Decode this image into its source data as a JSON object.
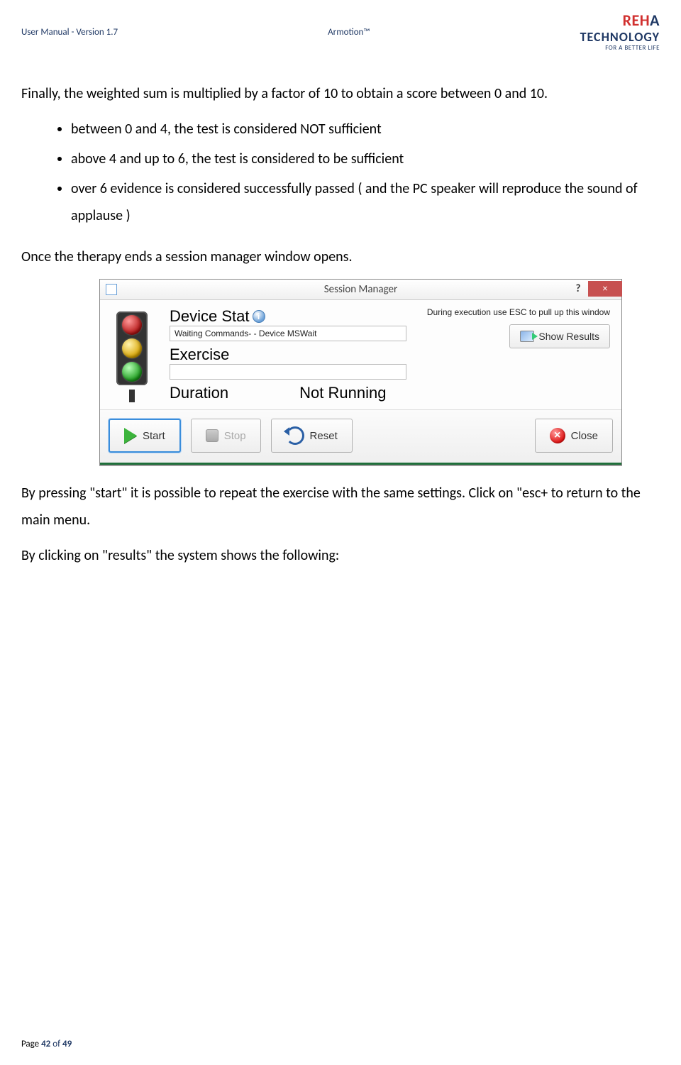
{
  "header": {
    "left": "User Manual - Version 1.7",
    "center": "Armotion™",
    "logo_line1_a": "REH",
    "logo_line1_b": "A",
    "logo_line2": "TECHNOLOGY",
    "logo_tag": "FOR A BETTER LIFE"
  },
  "body": {
    "p1": "Finally, the weighted sum is multiplied by a factor of 10 to obtain a score between 0 and 10.",
    "bullets": [
      "between 0 and 4, the test is considered NOT sufficient",
      "above 4 and up to 6, the test is considered to be sufficient",
      "over 6 evidence is considered successfully passed ( and the PC speaker will reproduce the sound of applause )"
    ],
    "p2": "Once the therapy ends a session manager window opens.",
    "p3": "By pressing \"start\" it is possible to repeat the exercise with the same settings. Click on \"esc+ to return to the main menu.",
    "p4": "By clicking on \"results\" the system shows the following:"
  },
  "session_manager": {
    "title": "Session Manager",
    "help_glyph": "?",
    "close_glyph": "×",
    "hint": "During execution use ESC to pull up this window",
    "device_status_label_short": "Device Stat",
    "device_status_value": "Waiting Commands- - Device MSWait",
    "exercise_label": "Exercise",
    "duration_label": "Duration",
    "duration_value": "Not Running",
    "info_glyph": "i",
    "buttons": {
      "show_results": "Show Results",
      "start": "Start",
      "stop": "Stop",
      "reset": "Reset",
      "close": "Close"
    }
  },
  "footer": {
    "page_label": "Page ",
    "page_num": "42",
    "of_label": " of ",
    "total": "49"
  }
}
